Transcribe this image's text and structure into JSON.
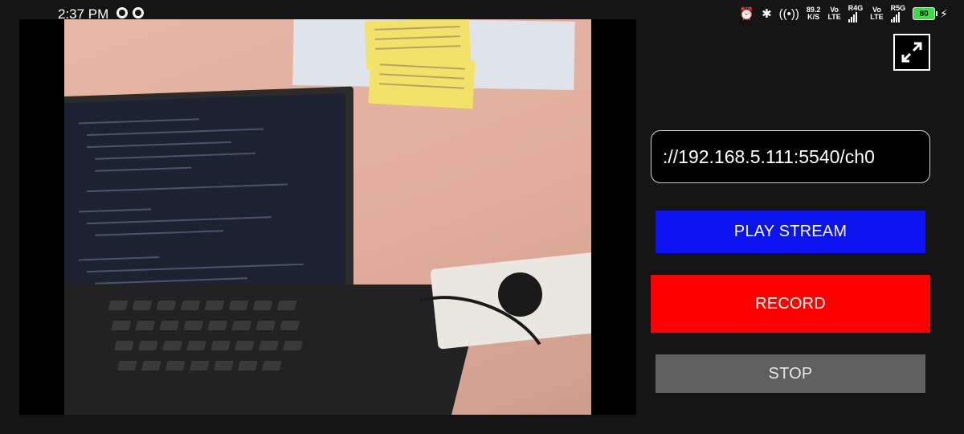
{
  "status_bar": {
    "time": "2:37 PM",
    "net_speed_value": "89.2",
    "net_speed_unit": "K/S",
    "sim1_top": "Vo",
    "sim1_bottom": "LTE",
    "sim1_network": "R4G",
    "sim2_top": "Vo",
    "sim2_bottom": "LTE",
    "sim2_network": "R5G",
    "battery": "80",
    "icons": [
      "alarm-icon",
      "bluetooth-icon",
      "hotspot-icon",
      "signal-icon",
      "battery-icon",
      "charging-icon"
    ]
  },
  "controls": {
    "url_value": "://192.168.5.111:5540/ch0",
    "play_label": "PLAY STREAM",
    "record_label": "RECORD",
    "stop_label": "STOP"
  },
  "colors": {
    "background": "#141414",
    "play": "#0d12f0",
    "record": "#ff0000",
    "stop": "#5f5f5f"
  }
}
